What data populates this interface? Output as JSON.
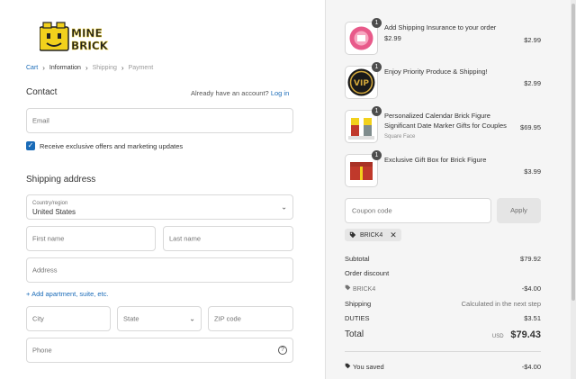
{
  "logo": {
    "line1": "MINE",
    "line2": "BRICK"
  },
  "breadcrumb": [
    "Cart",
    "Information",
    "Shipping",
    "Payment"
  ],
  "contact": {
    "heading": "Contact",
    "account_prompt": "Already have an account?",
    "login_label": "Log in",
    "email_placeholder": "Email",
    "offers_label": "Receive exclusive offers and marketing updates",
    "offers_checked": true
  },
  "shipping": {
    "heading": "Shipping address",
    "country_label": "Country/region",
    "country_value": "United States",
    "first_name_placeholder": "First name",
    "last_name_placeholder": "Last name",
    "address_placeholder": "Address",
    "add_apartment_label": "Add apartment, suite, etc.",
    "city_placeholder": "City",
    "state_placeholder": "State",
    "zip_placeholder": "ZIP code",
    "phone_placeholder": "Phone"
  },
  "order": {
    "items": [
      {
        "qty": "1",
        "title": "Add Shipping Insurance to your order",
        "subtitle": "$2.99",
        "price": "$2.99"
      },
      {
        "qty": "1",
        "title": "Enjoy Priority Produce & Shipping!",
        "subtitle": "",
        "price": "$2.99"
      },
      {
        "qty": "1",
        "title": "Personalized Calendar Brick Figure Significant Date Marker Gifts for Couples",
        "subtitle": "Square Face",
        "price": "$69.95"
      },
      {
        "qty": "1",
        "title": "Exclusive Gift Box for Brick Figure",
        "subtitle": "",
        "price": "$3.99"
      }
    ],
    "coupon_placeholder": "Coupon code",
    "apply_label": "Apply",
    "applied_code": "BRICK4",
    "subtotal_label": "Subtotal",
    "subtotal_value": "$79.92",
    "discount_label": "Order discount",
    "discount_code": "BRICK4",
    "discount_value": "-$4.00",
    "shipping_label": "Shipping",
    "shipping_value": "Calculated in the next step",
    "duties_label": "DUTIES",
    "duties_value": "$3.51",
    "total_label": "Total",
    "total_currency": "USD",
    "total_value": "$79.43",
    "saved_label": "You saved",
    "saved_value": "-$4.00"
  },
  "colors": {
    "accent": "#1a6bb8",
    "logo_yellow": "#f2d11c",
    "summary_bg": "#f5f5f5"
  },
  "icons": [
    "chevron-right-icon",
    "checkbox-check-icon",
    "chevron-down-icon",
    "plus-icon",
    "help-circle-icon",
    "tag-icon",
    "close-icon"
  ]
}
